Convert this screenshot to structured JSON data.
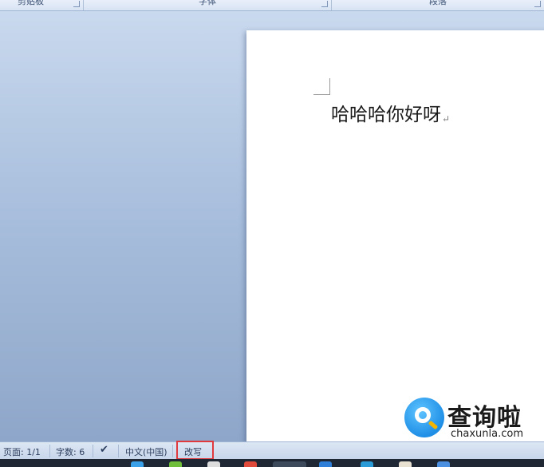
{
  "ribbon": {
    "groups": [
      "剪贴板",
      "字体",
      "段落"
    ]
  },
  "document": {
    "text": "哈哈哈你好呀",
    "paragraph_mark": "↵"
  },
  "statusbar": {
    "page": "页面: 1/1",
    "word_count": "字数: 6",
    "language": "中文(中国)",
    "input_mode": "改写"
  },
  "watermark": {
    "title": "查询啦",
    "url": "chaxunla.com"
  },
  "colors": {
    "highlight": "#e0393e",
    "watermark_blue": "#1f8fe6"
  }
}
